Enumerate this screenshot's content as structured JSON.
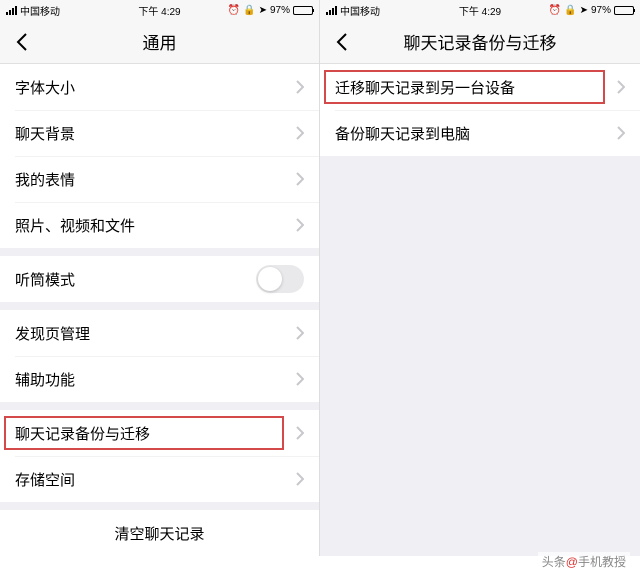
{
  "status": {
    "carrier": "中国移动",
    "time": "下午 4:29",
    "alarm": "⏰",
    "lock": "🔒",
    "loc": "➤",
    "battery_pct": "97%"
  },
  "left": {
    "title": "通用",
    "groups": [
      {
        "items": [
          {
            "label": "字体大小",
            "type": "chevron"
          },
          {
            "label": "聊天背景",
            "type": "chevron"
          },
          {
            "label": "我的表情",
            "type": "chevron"
          },
          {
            "label": "照片、视频和文件",
            "type": "chevron"
          }
        ]
      },
      {
        "items": [
          {
            "label": "听筒模式",
            "type": "toggle"
          }
        ]
      },
      {
        "items": [
          {
            "label": "发现页管理",
            "type": "chevron"
          },
          {
            "label": "辅助功能",
            "type": "chevron"
          }
        ]
      },
      {
        "items": [
          {
            "label": "聊天记录备份与迁移",
            "type": "chevron",
            "highlight": true
          },
          {
            "label": "存储空间",
            "type": "chevron"
          }
        ]
      }
    ],
    "clear_label": "清空聊天记录"
  },
  "right": {
    "title": "聊天记录备份与迁移",
    "items": [
      {
        "label": "迁移聊天记录到另一台设备",
        "type": "chevron",
        "highlight": true
      },
      {
        "label": "备份聊天记录到电脑",
        "type": "chevron"
      }
    ]
  },
  "watermark": {
    "prefix": "头条",
    "at": "@",
    "name": "手机教授"
  }
}
